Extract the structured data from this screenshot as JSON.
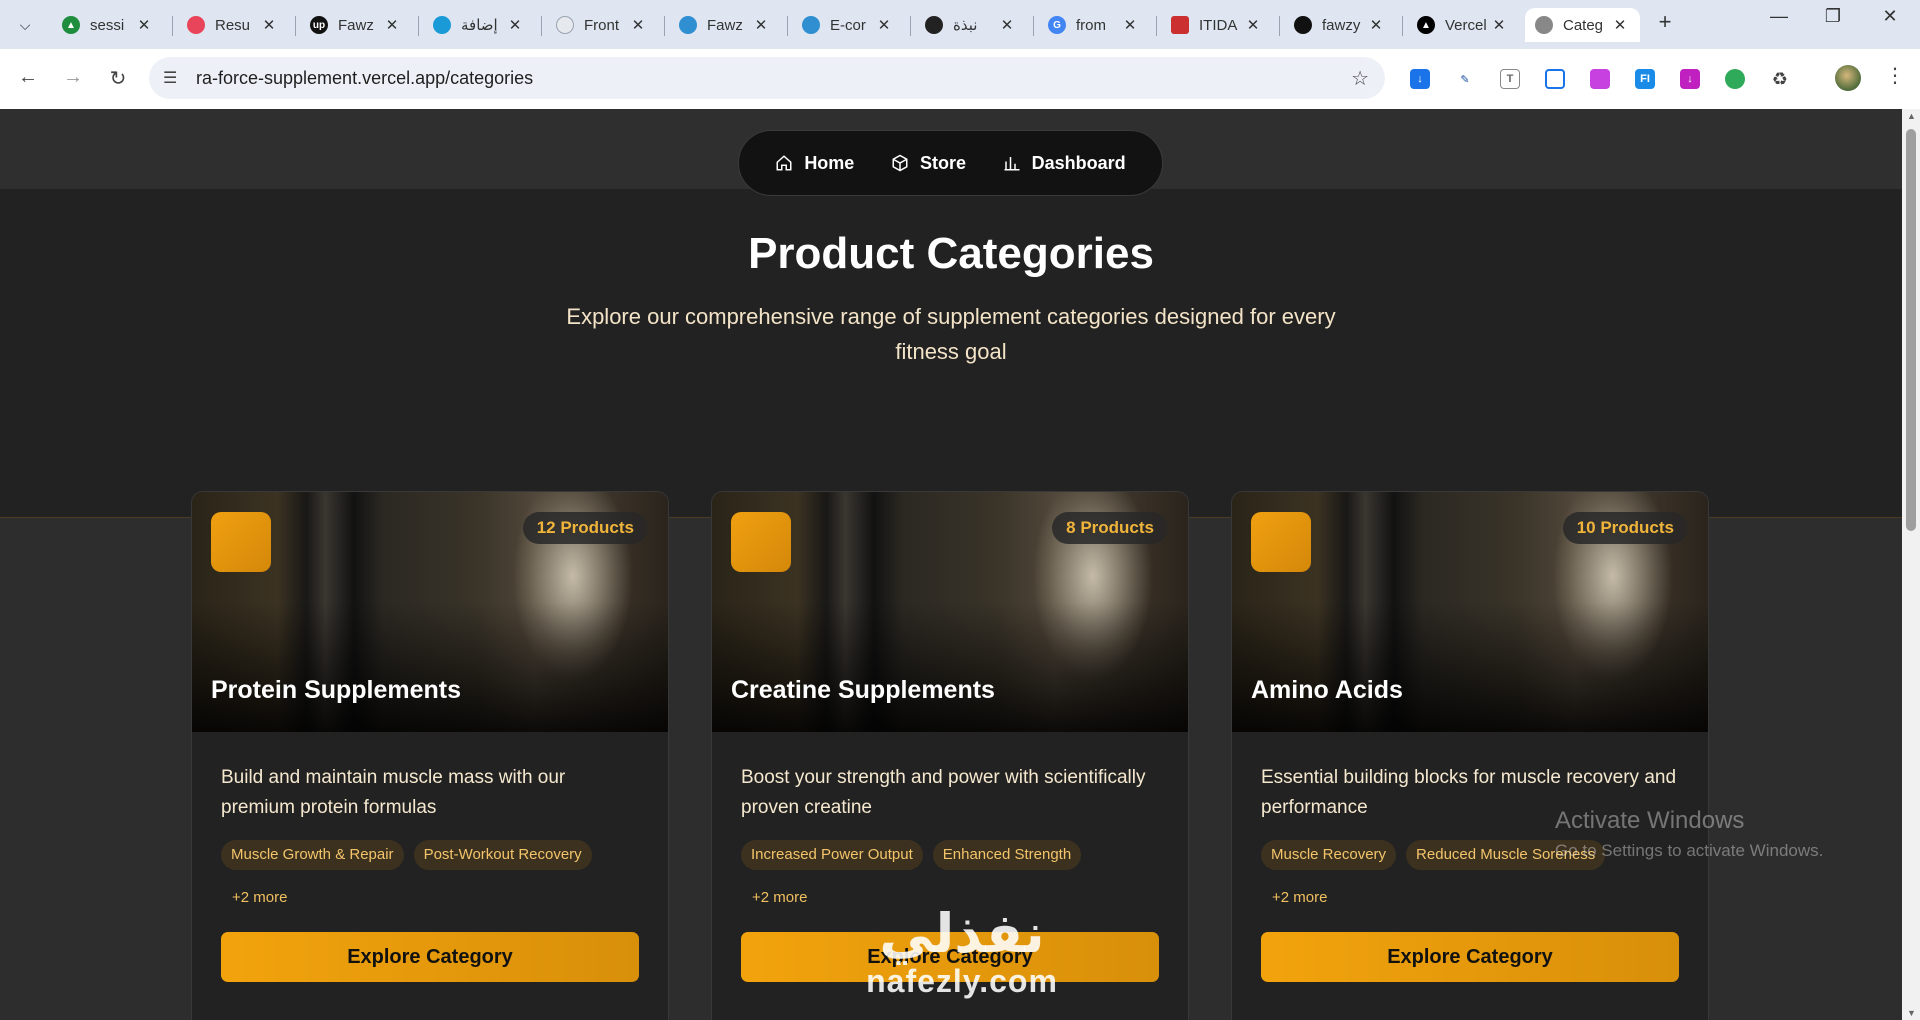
{
  "browser": {
    "tabs": [
      {
        "title": "sessi",
        "favicon": "drive-icon",
        "color": "#1e8e3e"
      },
      {
        "title": "Resu",
        "favicon": "resume-icon",
        "color": "#e8455a"
      },
      {
        "title": "Fawz",
        "favicon": "upwork-icon",
        "color": "#111111"
      },
      {
        "title": "إضافة",
        "favicon": "circle-icon",
        "color": "#1a9bd7"
      },
      {
        "title": "Front",
        "favicon": "page-icon",
        "color": "#9aa3b0"
      },
      {
        "title": "Fawz",
        "favicon": "flutter-icon",
        "color": "#2f8fd0"
      },
      {
        "title": "E-cor",
        "favicon": "flutter-icon",
        "color": "#2f8fd0"
      },
      {
        "title": "نبذة",
        "favicon": "openai-icon",
        "color": "#222222"
      },
      {
        "title": "from",
        "favicon": "google-icon",
        "color": "#4285f4"
      },
      {
        "title": "ITIDA",
        "favicon": "itida-icon",
        "color": "#cc2f2f"
      },
      {
        "title": "fawzy",
        "favicon": "github-icon",
        "color": "#111111"
      },
      {
        "title": "Vercel",
        "favicon": "vercel-icon",
        "color": "#000000"
      },
      {
        "title": "Categ",
        "favicon": "globe-icon",
        "color": "#777777"
      }
    ],
    "url": "ra-force-supplement.vercel.app/categories"
  },
  "nav": {
    "home": "Home",
    "store": "Store",
    "dashboard": "Dashboard"
  },
  "hero": {
    "title": "Product Categories",
    "subtitle": "Explore our comprehensive range of supplement categories designed for every fitness goal"
  },
  "categories": [
    {
      "title": "Protein Supplements",
      "count": "12 Products",
      "description": "Build and maintain muscle mass with our premium protein formulas",
      "tags": [
        "Muscle Growth & Repair",
        "Post-Workout Recovery"
      ],
      "more": "+2 more",
      "button": "Explore Category"
    },
    {
      "title": "Creatine Supplements",
      "count": "8 Products",
      "description": "Boost your strength and power with scientifically proven creatine",
      "tags": [
        "Increased Power Output",
        "Enhanced Strength"
      ],
      "more": "+2 more",
      "button": "Explore Category"
    },
    {
      "title": "Amino Acids",
      "count": "10 Products",
      "description": "Essential building blocks for muscle recovery and performance",
      "tags": [
        "Muscle Recovery",
        "Reduced Muscle Soreness"
      ],
      "more": "+2 more",
      "button": "Explore Category"
    }
  ],
  "overlay": {
    "activate_title": "Activate Windows",
    "activate_sub": "Go to Settings to activate Windows.",
    "logo_ar": "نفذلي",
    "logo_en": "nafezly.com"
  },
  "theme": {
    "accent": "#f0a010",
    "background": "#2d2d2d",
    "card": "#222222"
  }
}
